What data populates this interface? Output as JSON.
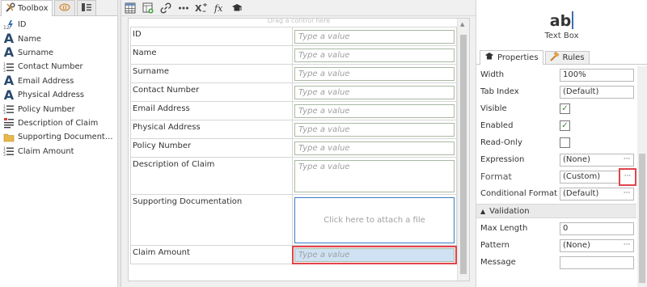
{
  "toolbox": {
    "tabs": [
      {
        "label": "Toolbox",
        "icon": "wrench-screwdriver-icon"
      },
      {
        "label": "",
        "icon": "data-tag-icon"
      },
      {
        "label": "",
        "icon": "list-view-icon"
      }
    ],
    "items": [
      {
        "label": "ID",
        "icon": "autonumber-icon"
      },
      {
        "label": "Name",
        "icon": "text-A-icon"
      },
      {
        "label": "Surname",
        "icon": "text-A-icon"
      },
      {
        "label": "Contact Number",
        "icon": "number-list-icon"
      },
      {
        "label": "Email Address",
        "icon": "text-A-icon"
      },
      {
        "label": "Physical Address",
        "icon": "text-A-icon"
      },
      {
        "label": "Policy Number",
        "icon": "number-list-icon"
      },
      {
        "label": "Description of Claim",
        "icon": "memo-icon"
      },
      {
        "label": "Supporting Documenta...",
        "icon": "folder-icon"
      },
      {
        "label": "Claim Amount",
        "icon": "number-list-icon"
      }
    ]
  },
  "canvas": {
    "toolbar_icons": [
      "table-icon",
      "add-layout-icon",
      "link-icon",
      "ellipsis-icon",
      "variable-icon",
      "function-icon",
      "rule-icon"
    ],
    "drop_hint": "Drag a control here",
    "rows": [
      {
        "label": "ID",
        "placeholder": "Type a value",
        "kind": "input"
      },
      {
        "label": "Name",
        "placeholder": "Type a value",
        "kind": "input"
      },
      {
        "label": "Surname",
        "placeholder": "Type a value",
        "kind": "input"
      },
      {
        "label": "Contact Number",
        "placeholder": "Type a value",
        "kind": "input"
      },
      {
        "label": "Email Address",
        "placeholder": "Type a value",
        "kind": "input"
      },
      {
        "label": "Physical Address",
        "placeholder": "Type a value",
        "kind": "input"
      },
      {
        "label": "Policy Number",
        "placeholder": "Type a value",
        "kind": "input"
      },
      {
        "label": "Description of Claim",
        "placeholder": "Type a value",
        "kind": "textarea"
      },
      {
        "label": "Supporting Documentation",
        "placeholder": "Click here to attach a file",
        "kind": "attachment"
      },
      {
        "label": "Claim Amount",
        "placeholder": "Type a value",
        "kind": "selected"
      }
    ]
  },
  "properties": {
    "control_icon_text": "ab",
    "control_name": "Text Box",
    "tabs": [
      {
        "label": "Properties",
        "icon": "properties-icon"
      },
      {
        "label": "Rules",
        "icon": "rules-icon"
      }
    ],
    "rows": [
      {
        "name": "Width",
        "type": "text",
        "value": "100%"
      },
      {
        "name": "Tab Index",
        "type": "text",
        "value": "(Default)"
      },
      {
        "name": "Visible",
        "type": "check",
        "checked": true
      },
      {
        "name": "Enabled",
        "type": "check",
        "checked": true
      },
      {
        "name": "Read-Only",
        "type": "check",
        "checked": false
      },
      {
        "name": "Expression",
        "type": "ellipsis",
        "value": "(None)"
      },
      {
        "name": "Format",
        "type": "ellipsis",
        "value": "(Custom)",
        "highlight": true,
        "large": true
      },
      {
        "name": "Conditional Format",
        "type": "ellipsis",
        "value": "(Default)"
      },
      {
        "section": "Validation"
      },
      {
        "name": "Max Length",
        "type": "text",
        "value": "0"
      },
      {
        "name": "Pattern",
        "type": "ellipsis",
        "value": "(None)"
      },
      {
        "name": "Message",
        "type": "text",
        "value": ""
      }
    ]
  },
  "colors": {
    "accent_blue": "#3a7cc2",
    "highlight_red": "#e0434b",
    "check_green": "#3d8a3d"
  }
}
